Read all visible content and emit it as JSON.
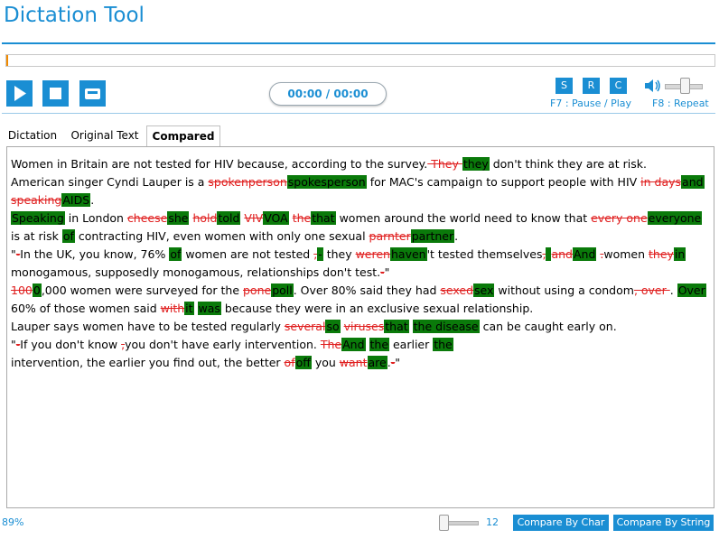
{
  "app": {
    "title": "Dictation Tool"
  },
  "player": {
    "time": "00:00 / 00:00",
    "icons": {
      "play": "play-icon",
      "stop": "stop-icon",
      "save": "save-icon",
      "volume": "speaker-icon"
    },
    "mini_buttons": [
      "S",
      "R",
      "C"
    ],
    "hint_pause": "F7 : Pause / Play",
    "hint_repeat": "F8 : Repeat"
  },
  "tabs": [
    {
      "label": "Dictation",
      "active": false
    },
    {
      "label": "Original Text",
      "active": false
    },
    {
      "label": "Compared",
      "active": true
    }
  ],
  "comparison": {
    "lines": [
      [
        [
          "n",
          "Women in Britain are not tested for HIV because, according to the survey."
        ],
        [
          "d",
          " They "
        ],
        [
          "n",
          " "
        ],
        [
          "i",
          "they"
        ],
        [
          "n",
          " don't think they are at risk."
        ]
      ],
      [
        [
          "n",
          "American singer Cyndi Lauper is a "
        ],
        [
          "d",
          "spokenperson"
        ],
        [
          "i",
          "spokesperson"
        ],
        [
          "n",
          " for MAC's campaign to support people with HIV "
        ],
        [
          "d",
          "in days"
        ],
        [
          "i",
          "and"
        ]
      ],
      [
        [
          "d",
          "speaking"
        ],
        [
          "i",
          "AIDS"
        ],
        [
          "n",
          "."
        ]
      ],
      [
        [
          "i",
          "Speaking"
        ],
        [
          "n",
          " in London "
        ],
        [
          "d",
          "cheese"
        ],
        [
          "i",
          "she"
        ],
        [
          "n",
          " "
        ],
        [
          "d",
          "hold"
        ],
        [
          "i",
          "told"
        ],
        [
          "n",
          " "
        ],
        [
          "d",
          "VIV"
        ],
        [
          "i",
          "VOA"
        ],
        [
          "n",
          " "
        ],
        [
          "d",
          "the"
        ],
        [
          "i",
          "that"
        ],
        [
          "n",
          " women around the world need to know that "
        ],
        [
          "d",
          "every one"
        ],
        [
          "i",
          "everyone"
        ]
      ],
      [
        [
          "n",
          " is at risk "
        ],
        [
          "i",
          "of"
        ],
        [
          "n",
          " contracting HIV, even women with only one sexual "
        ],
        [
          "d",
          "parnter"
        ],
        [
          "i",
          "partner"
        ],
        [
          "n",
          "."
        ]
      ],
      [
        [
          "n",
          "\""
        ],
        [
          "d",
          "-"
        ],
        [
          "n",
          "In the UK, you know, 76% "
        ],
        [
          "i",
          "of"
        ],
        [
          "n",
          " women are not tested "
        ],
        [
          "d",
          ","
        ],
        [
          "i",
          "-"
        ],
        [
          "n",
          " they "
        ],
        [
          "d",
          "weren"
        ],
        [
          "i",
          "haven"
        ],
        [
          "n",
          "'t tested themselves"
        ],
        [
          "d",
          ","
        ],
        [
          "i",
          " "
        ],
        [
          "n",
          " "
        ],
        [
          "d",
          "and"
        ],
        [
          "i",
          "And"
        ],
        [
          "n",
          " "
        ],
        [
          "d",
          "."
        ],
        [
          "n",
          "women "
        ],
        [
          "d",
          "they"
        ],
        [
          "i",
          "in"
        ]
      ],
      [
        [
          "n",
          " monogamous, supposedly monogamous, relationships don't test."
        ],
        [
          "d",
          "-"
        ],
        [
          "n",
          "\""
        ]
      ],
      [
        [
          "d",
          "100"
        ],
        [
          "i",
          "0"
        ],
        [
          "n",
          ",000 women were surveyed for the "
        ],
        [
          "d",
          "pone"
        ],
        [
          "i",
          "poll"
        ],
        [
          "n",
          ". Over 80% said they had "
        ],
        [
          "d",
          "sexed"
        ],
        [
          "i",
          "sex"
        ],
        [
          "n",
          " without using a condom"
        ],
        [
          "d",
          ", over "
        ],
        [
          "n",
          ". "
        ],
        [
          "i",
          "Over"
        ]
      ],
      [
        [
          "n",
          "60% of those women said "
        ],
        [
          "d",
          "with"
        ],
        [
          "i",
          "it"
        ],
        [
          "n",
          " "
        ],
        [
          "i",
          "was"
        ],
        [
          "n",
          " because they were in an exclusive sexual relationship."
        ]
      ],
      [
        [
          "n",
          "Lauper says women have to be tested regularly "
        ],
        [
          "d",
          "several"
        ],
        [
          "i",
          "so"
        ],
        [
          "n",
          " "
        ],
        [
          "d",
          "viruses"
        ],
        [
          "i",
          "that"
        ],
        [
          "n",
          " "
        ],
        [
          "i",
          "the disease"
        ],
        [
          "n",
          " can be caught early on."
        ]
      ],
      [
        [
          "n",
          "\""
        ],
        [
          "d",
          "-"
        ],
        [
          "n",
          "If you don't know "
        ],
        [
          "d",
          ","
        ],
        [
          "n",
          "you don't have early intervention. "
        ],
        [
          "d",
          "The"
        ],
        [
          "i",
          "And"
        ],
        [
          "n",
          " "
        ],
        [
          "i",
          "the"
        ],
        [
          "n",
          " earlier "
        ],
        [
          "i",
          "the"
        ]
      ],
      [
        [
          "n",
          "intervention, the earlier you find out, the better "
        ],
        [
          "d",
          "of"
        ],
        [
          "i",
          "off"
        ],
        [
          "n",
          " you "
        ],
        [
          "d",
          "want"
        ],
        [
          "i",
          "are"
        ],
        [
          "n",
          "."
        ],
        [
          "d",
          "-"
        ],
        [
          "n",
          "\""
        ]
      ]
    ]
  },
  "footer": {
    "zoom": "89%",
    "font_size": "12",
    "compare_char": "Compare By Char",
    "compare_string": "Compare By String"
  }
}
